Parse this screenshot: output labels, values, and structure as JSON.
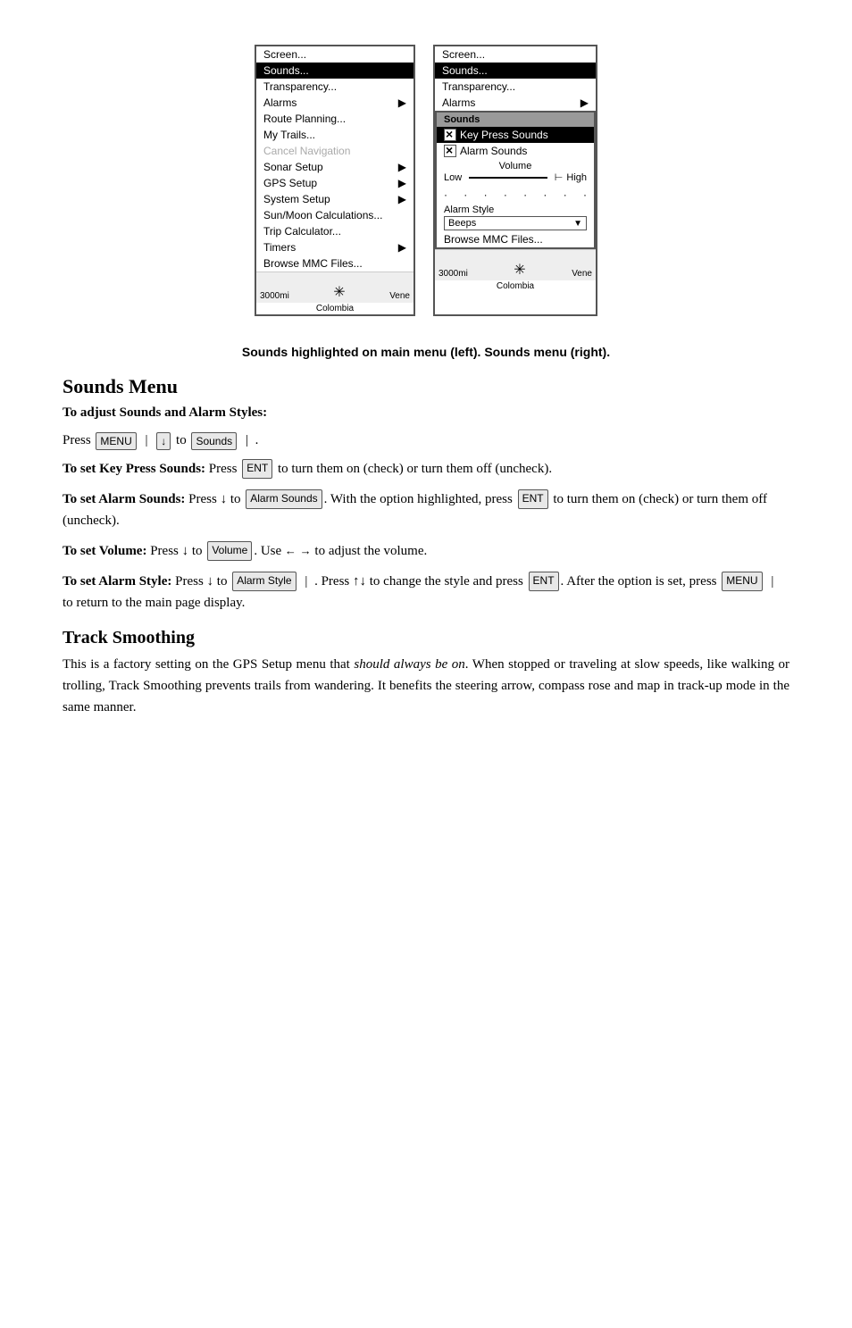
{
  "caption": "Sounds highlighted on main menu (left). Sounds menu (right).",
  "leftMenu": {
    "items": [
      {
        "label": "Screen...",
        "highlighted": false,
        "disabled": false,
        "hasArrow": false
      },
      {
        "label": "Sounds...",
        "highlighted": true,
        "disabled": false,
        "hasArrow": false
      },
      {
        "label": "Transparency...",
        "highlighted": false,
        "disabled": false,
        "hasArrow": false
      },
      {
        "label": "Alarms",
        "highlighted": false,
        "disabled": false,
        "hasArrow": true
      },
      {
        "label": "Route Planning...",
        "highlighted": false,
        "disabled": false,
        "hasArrow": false
      },
      {
        "label": "My Trails...",
        "highlighted": false,
        "disabled": false,
        "hasArrow": false
      },
      {
        "label": "Cancel Navigation",
        "highlighted": false,
        "disabled": true,
        "hasArrow": false
      },
      {
        "label": "Sonar Setup",
        "highlighted": false,
        "disabled": false,
        "hasArrow": true
      },
      {
        "label": "GPS Setup",
        "highlighted": false,
        "disabled": false,
        "hasArrow": true
      },
      {
        "label": "System Setup",
        "highlighted": false,
        "disabled": false,
        "hasArrow": true
      },
      {
        "label": "Sun/Moon Calculations...",
        "highlighted": false,
        "disabled": false,
        "hasArrow": false
      },
      {
        "label": "Trip Calculator...",
        "highlighted": false,
        "disabled": false,
        "hasArrow": false
      },
      {
        "label": "Timers",
        "highlighted": false,
        "disabled": false,
        "hasArrow": true
      },
      {
        "label": "Browse MMC Files...",
        "highlighted": false,
        "disabled": false,
        "hasArrow": false
      }
    ],
    "footer": {
      "left": "3000mi",
      "right": "Colombia"
    }
  },
  "rightMenu": {
    "mainItems": [
      {
        "label": "Screen...",
        "highlighted": false
      },
      {
        "label": "Sounds...",
        "highlighted": true
      },
      {
        "label": "Transparency...",
        "highlighted": false
      },
      {
        "label": "Alarms",
        "highlighted": false,
        "hasArrow": true
      }
    ],
    "submenuHeader": "Sounds",
    "submenuItems": [
      {
        "label": "Key Press Sounds",
        "checked": true,
        "highlighted": true
      },
      {
        "label": "Alarm Sounds",
        "checked": true,
        "highlighted": false
      }
    ],
    "volumeLabel": "Volume",
    "volumeLow": "Low",
    "volumeHigh": "High",
    "alarmStyleLabel": "Alarm Style",
    "alarmStyleValue": "Beeps",
    "browseLabel": "Browse MMC Files...",
    "footer": {
      "left": "3000mi",
      "right": "Colombia"
    }
  },
  "soundsMenu": {
    "heading": "Sounds Menu",
    "subheading": "To adjust Sounds and Alarm Styles:",
    "instructions": {
      "line1": "Press  |  |↓ to  |  .",
      "keyPressLine": "To set Key Press Sounds: Press  to turn them on (check) or turn them off (uncheck).",
      "alarmSoundsLine": "To set Alarm Sounds: Press ↓ to  With the option highlighted, press  to turn them on (check) or turn them off (uncheck).",
      "volumeLine": "To set Volume: Press ↓ to  . Use ← → to adjust the volume.",
      "alarmStyleLine": "To set Alarm Style: Press ↓ to  |  . Press ↑↓ to change the style and press  . After the option is set, press  |  to return to the main page display."
    }
  },
  "trackSmoothing": {
    "heading": "Track Smoothing",
    "body": "This is a factory setting on the GPS Setup menu that should always be on. When stopped or traveling at slow speeds, like walking or trolling, Track Smoothing prevents trails from wandering. It benefits the steering arrow, compass rose and map in track-up mode in the same manner."
  }
}
